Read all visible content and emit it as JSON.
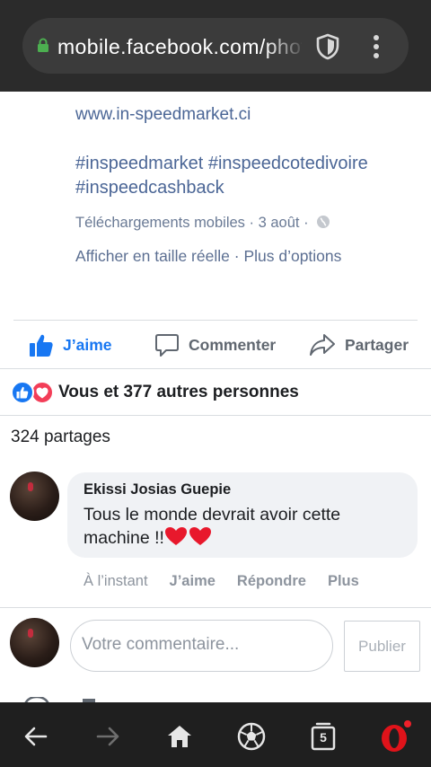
{
  "browser": {
    "url": "mobile.facebook.com/photo",
    "tab_count": "5"
  },
  "post": {
    "link": "www.in-speedmarket.ci",
    "hashtags": "#inspeedmarket #inspeedcotedivoire #inspeedcashback",
    "album": "Téléchargements mobiles",
    "date": "3 août",
    "view_full": "Afficher en taille réelle",
    "more_options": "Plus d’options"
  },
  "actions": {
    "like": "J’aime",
    "comment": "Commenter",
    "share": "Partager"
  },
  "reactions": {
    "summary": "Vous et 377 autres personnes"
  },
  "shares": "324 partages",
  "comment": {
    "author": "Ekissi Josias Guepie",
    "text": "Tous le monde devrait avoir cette machine !!",
    "time": "À l’instant",
    "like": "J’aime",
    "reply": "Répondre",
    "more": "Plus"
  },
  "composer": {
    "placeholder": "Votre commentaire...",
    "publish": "Publier"
  },
  "colors": {
    "facebook_blue": "#1877f2",
    "link_blue": "#4b6696",
    "love_red": "#f33e58",
    "browser_bar": "#2b2b2b",
    "opera_red": "#e0131a"
  }
}
